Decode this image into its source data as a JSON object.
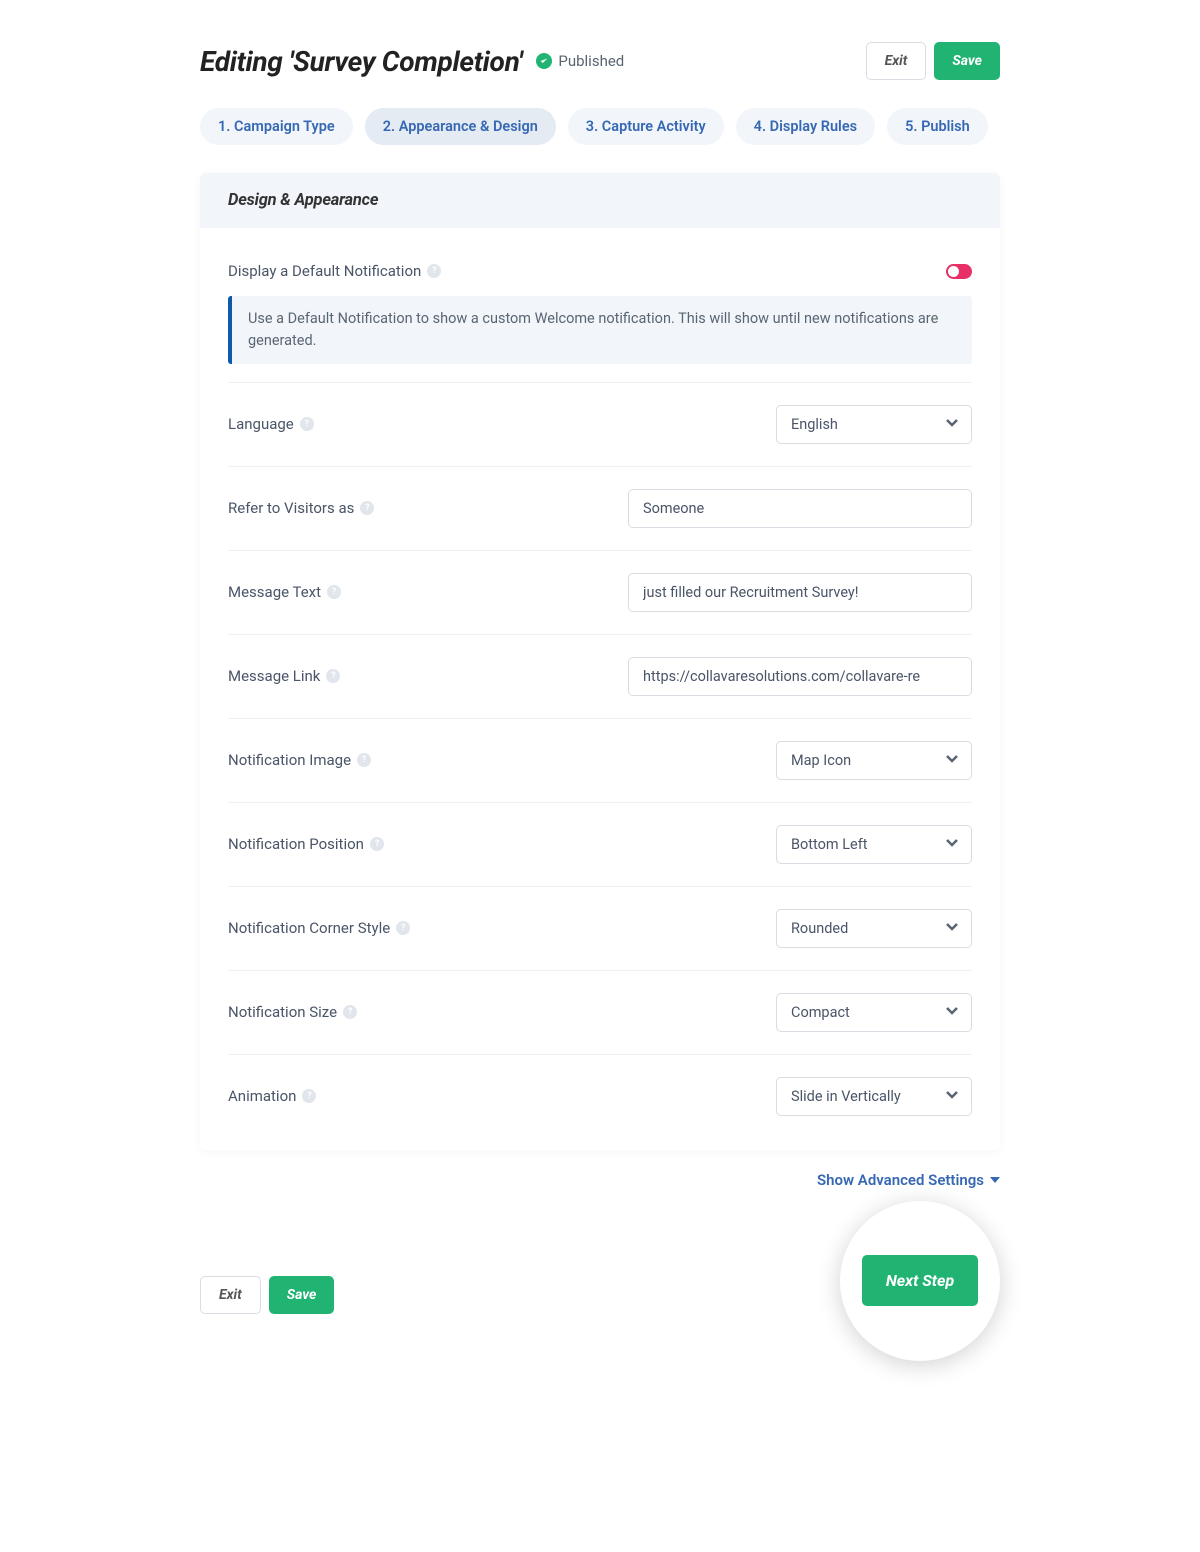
{
  "header": {
    "title": "Editing 'Survey Completion'",
    "status_label": "Published",
    "exit_label": "Exit",
    "save_label": "Save"
  },
  "tabs": [
    {
      "label": "1. Campaign Type"
    },
    {
      "label": "2. Appearance & Design"
    },
    {
      "label": "3. Capture Activity"
    },
    {
      "label": "4. Display Rules"
    },
    {
      "label": "5. Publish"
    }
  ],
  "panel": {
    "title": "Design & Appearance",
    "default_notification_label": "Display a Default Notification",
    "info_text": "Use a Default Notification to show a custom Welcome notification. This will show until new notifications are generated.",
    "fields": {
      "language": {
        "label": "Language",
        "value": "English"
      },
      "refer_as": {
        "label": "Refer to Visitors as",
        "value": "Someone"
      },
      "message_text": {
        "label": "Message Text",
        "value": "just filled our Recruitment Survey!"
      },
      "message_link": {
        "label": "Message Link",
        "value": "https://collavaresolutions.com/collavare-re"
      },
      "notification_image": {
        "label": "Notification Image",
        "value": "Map Icon"
      },
      "notification_position": {
        "label": "Notification Position",
        "value": "Bottom Left"
      },
      "corner_style": {
        "label": "Notification Corner Style",
        "value": "Rounded"
      },
      "notification_size": {
        "label": "Notification Size",
        "value": "Compact"
      },
      "animation": {
        "label": "Animation",
        "value": "Slide in Vertically"
      }
    }
  },
  "advanced_link": "Show Advanced Settings",
  "footer": {
    "exit_label": "Exit",
    "save_label": "Save",
    "next_label": "Next Step"
  }
}
